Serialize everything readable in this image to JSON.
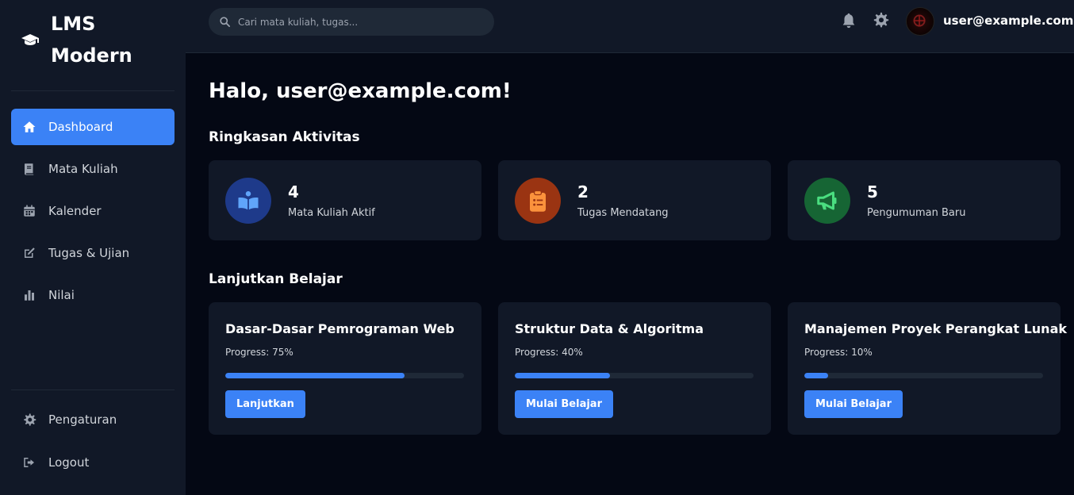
{
  "brand": {
    "title": "LMS Modern",
    "icon": "graduation-cap-icon"
  },
  "sidebar": {
    "items": [
      {
        "label": "Dashboard",
        "icon": "home-icon",
        "active": true
      },
      {
        "label": "Mata Kuliah",
        "icon": "book-icon",
        "active": false
      },
      {
        "label": "Kalender",
        "icon": "calendar-icon",
        "active": false
      },
      {
        "label": "Tugas & Ujian",
        "icon": "edit-icon",
        "active": false
      },
      {
        "label": "Nilai",
        "icon": "bar-chart-icon",
        "active": false
      }
    ],
    "bottom": [
      {
        "label": "Pengaturan",
        "icon": "gear-icon"
      },
      {
        "label": "Logout",
        "icon": "logout-icon"
      }
    ]
  },
  "topbar": {
    "search_placeholder": "Cari mata kuliah, tugas...",
    "user_email": "user@example.com"
  },
  "main": {
    "greeting": "Halo, user@example.com!",
    "summary_title": "Ringkasan Aktivitas",
    "stats": [
      {
        "value": "4",
        "label": "Mata Kuliah Aktif",
        "icon": "book-open-icon",
        "color": "#3b82f6",
        "bg": "#1e3a8a"
      },
      {
        "value": "2",
        "label": "Tugas Mendatang",
        "icon": "clipboard-list-icon",
        "color": "#f97316",
        "bg": "#9a3412"
      },
      {
        "value": "5",
        "label": "Pengumuman Baru",
        "icon": "bullhorn-icon",
        "color": "#22c55e",
        "bg": "#166534"
      }
    ],
    "continue_title": "Lanjutkan Belajar",
    "courses": [
      {
        "title": "Dasar-Dasar Pemrograman Web",
        "progress_text": "Progress: 75%",
        "progress": 0.75,
        "button": "Lanjutkan"
      },
      {
        "title": "Struktur Data & Algoritma",
        "progress_text": "Progress: 40%",
        "progress": 0.4,
        "button": "Mulai Belajar"
      },
      {
        "title": "Manajemen Proyek Perangkat Lunak",
        "progress_text": "Progress: 10%",
        "progress": 0.1,
        "button": "Mulai Belajar"
      }
    ]
  },
  "colors": {
    "accent": "#3b82f6",
    "sidebar_bg": "#111827",
    "page_bg": "#040814"
  }
}
